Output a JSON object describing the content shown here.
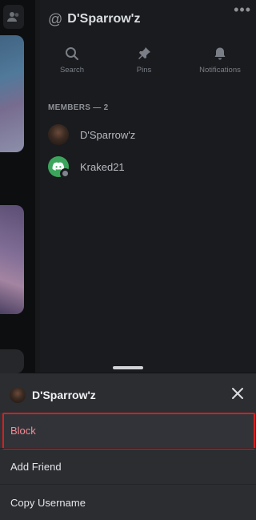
{
  "channel": {
    "title": "D'Sparrow'z",
    "more_label": "•••"
  },
  "actions": [
    {
      "label": "Search",
      "icon": "search-icon"
    },
    {
      "label": "Pins",
      "icon": "pin-icon"
    },
    {
      "label": "Notifications",
      "icon": "bell-icon"
    }
  ],
  "members": {
    "heading": "MEMBERS — 2",
    "list": [
      {
        "name": "D'Sparrow'z",
        "status": "none"
      },
      {
        "name": "Kraked21",
        "status": "offline"
      }
    ]
  },
  "sheet": {
    "title": "D'Sparrow'z",
    "items": [
      {
        "label": "Block",
        "highlighted": true
      },
      {
        "label": "Add Friend"
      },
      {
        "label": "Copy Username"
      }
    ]
  },
  "colors": {
    "background": "#121214",
    "panel": "#1a1b1e",
    "sheet": "#2b2d31",
    "block_text": "#f28b95",
    "highlight_border": "#d42020",
    "discord_green": "#3ba55c"
  }
}
